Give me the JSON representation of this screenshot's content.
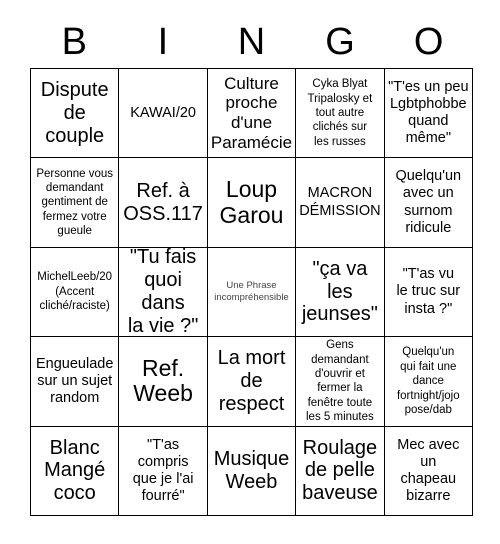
{
  "header": {
    "letters": [
      "B",
      "I",
      "N",
      "G",
      "O"
    ]
  },
  "grid": {
    "rows": 5,
    "columns": 5,
    "border_color": "#000000",
    "background_color": "#ffffff",
    "text_color": "#000000",
    "cells": [
      {
        "text": "Dispute\nde\ncouple",
        "size": "sz-xl"
      },
      {
        "text": "KAWAI/20",
        "size": "sz-m"
      },
      {
        "text": "Culture\nproche\nd'une\nParamécie",
        "size": "sz-l"
      },
      {
        "text": "Cyka Blyat\nTripalosky et\ntout autre\nclichés sur\nles russes",
        "size": "sz-s"
      },
      {
        "text": "\"T'es un peu\nLgbtphobbe\nquand\nmême\"",
        "size": "sz-m"
      },
      {
        "text": "Personne vous\ndemandant\ngentiment de\nfermez votre\ngueule",
        "size": "sz-s"
      },
      {
        "text": "Ref. à\nOSS.117",
        "size": "sz-xl"
      },
      {
        "text": "Loup\nGarou",
        "size": "sz-xxl"
      },
      {
        "text": "MACRON\nDÉMISSION",
        "size": "sz-m"
      },
      {
        "text": "Quelqu'un\navec un\nsurnom\nridicule",
        "size": "sz-m"
      },
      {
        "text": "MichelLeeb/20\n(Accent\ncliché/raciste)",
        "size": "sz-s"
      },
      {
        "text": "\"Tu fais\nquoi dans\nla vie ?\"",
        "size": "sz-xl"
      },
      {
        "text": "Une Phrase\nincompréhensible",
        "size": "sz-xs"
      },
      {
        "text": "\"ça va\nles\njeunses\"",
        "size": "sz-xl"
      },
      {
        "text": "\"T'as vu\nle truc sur\ninsta ?\"",
        "size": "sz-m"
      },
      {
        "text": "Engueulade\nsur un sujet\nrandom",
        "size": "sz-m"
      },
      {
        "text": "Ref.\nWeeb",
        "size": "sz-xxl"
      },
      {
        "text": "La mort\nde\nrespect",
        "size": "sz-xl"
      },
      {
        "text": "Gens\ndemandant\nd'ouvrir et\nfermer la\nfenêtre toute\nles 5 minutes",
        "size": "sz-s"
      },
      {
        "text": "Quelqu'un\nqui fait une\ndance\nfortnight/jojo\npose/dab",
        "size": "sz-s"
      },
      {
        "text": "Blanc\nMangé\ncoco",
        "size": "sz-xl"
      },
      {
        "text": "\"T'as\ncompris\nque je l'ai\nfourré\"",
        "size": "sz-m"
      },
      {
        "text": "Musique\nWeeb",
        "size": "sz-xl"
      },
      {
        "text": "Roulage\nde pelle\nbaveuse",
        "size": "sz-xl"
      },
      {
        "text": "Mec avec\nun\nchapeau\nbizarre",
        "size": "sz-m"
      }
    ]
  }
}
